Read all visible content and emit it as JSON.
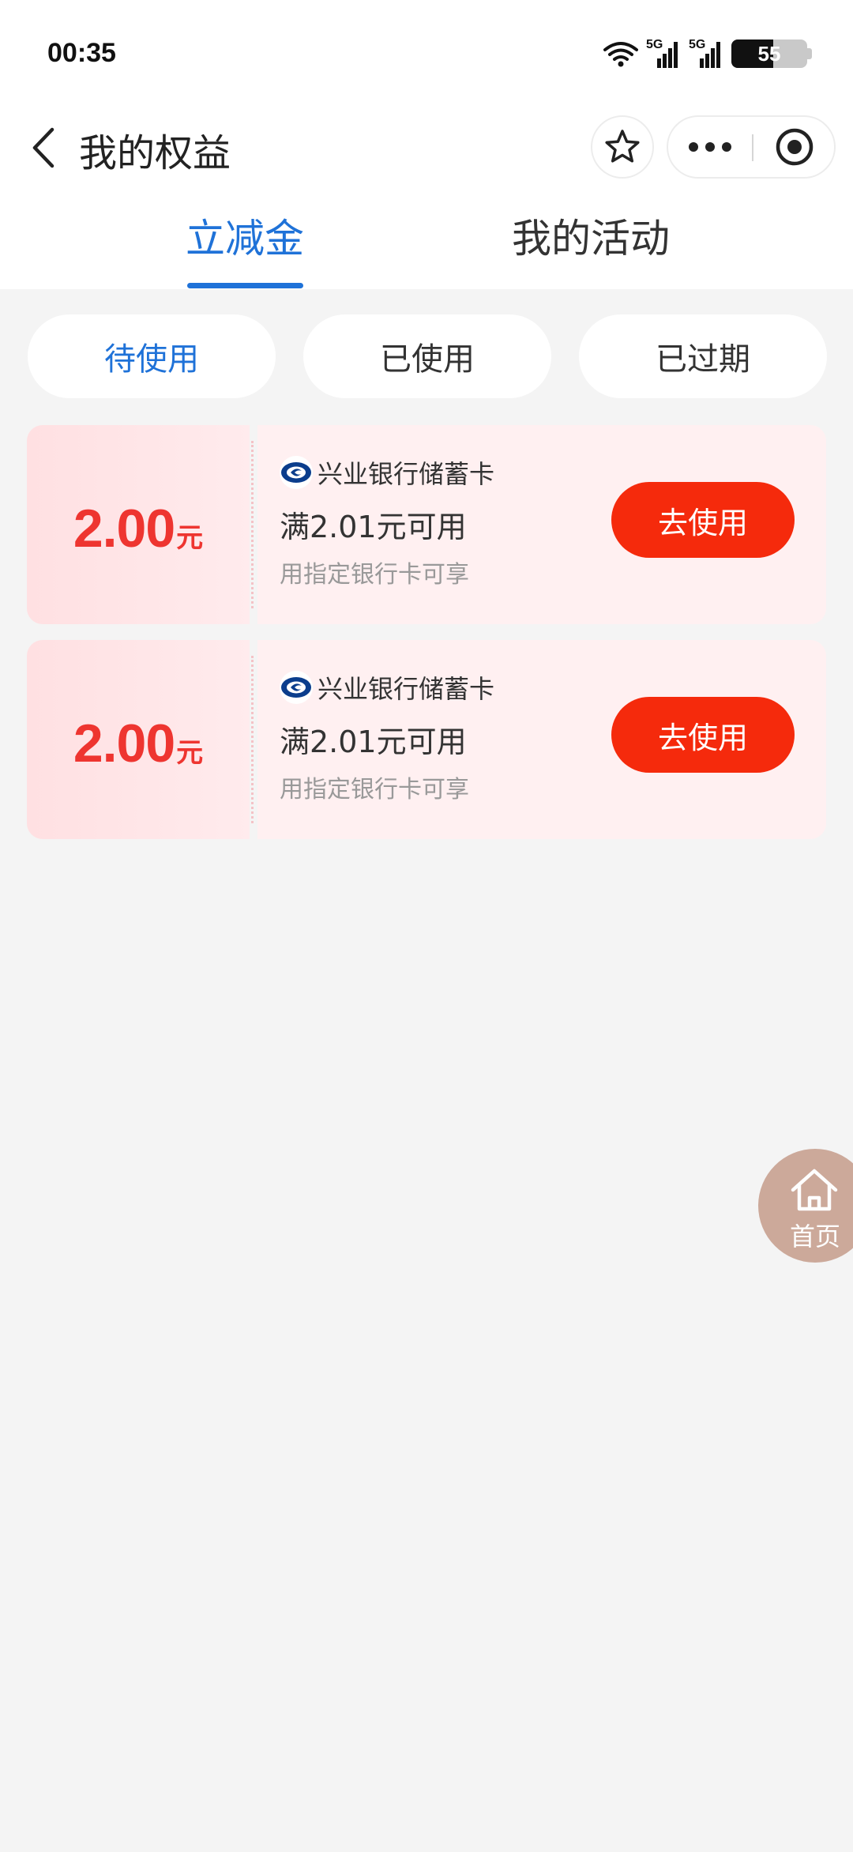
{
  "status_bar": {
    "time": "00:35",
    "network_1": "5G",
    "network_2": "5G",
    "battery": "55",
    "battery_level": 0.55
  },
  "nav": {
    "title": "我的权益"
  },
  "main_tabs": [
    {
      "label": "立减金",
      "active": true
    },
    {
      "label": "我的活动",
      "active": false
    }
  ],
  "filters": [
    {
      "label": "待使用",
      "active": true
    },
    {
      "label": "已使用",
      "active": false
    },
    {
      "label": "已过期",
      "active": false
    }
  ],
  "coupons": [
    {
      "amount": "2.00",
      "unit": "元",
      "bank": "兴业银行储蓄卡",
      "condition": "满2.01元可用",
      "note": "用指定银行卡可享",
      "button": "去使用"
    },
    {
      "amount": "2.00",
      "unit": "元",
      "bank": "兴业银行储蓄卡",
      "condition": "满2.01元可用",
      "note": "用指定银行卡可享",
      "button": "去使用"
    }
  ],
  "home_float": {
    "label": "首页",
    "icon": "home-icon"
  },
  "colors": {
    "accent_blue": "#1f72d8",
    "coupon_red": "#ee3530",
    "button_red": "#f52a0c",
    "background": "#f4f4f4"
  }
}
